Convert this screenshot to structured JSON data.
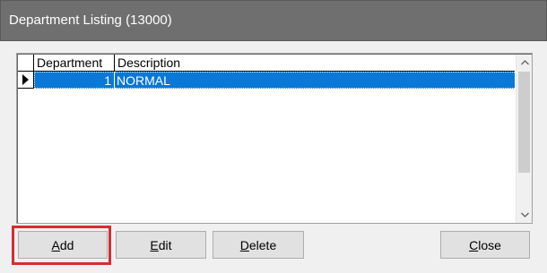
{
  "window": {
    "title": "Department Listing (13000)"
  },
  "grid": {
    "columns": [
      "Department",
      "Description"
    ],
    "rows": [
      {
        "department": "1",
        "description": "NORMAL",
        "selected": true
      }
    ]
  },
  "buttons": {
    "add": {
      "mnemonic": "A",
      "rest": "dd"
    },
    "edit": {
      "mnemonic": "E",
      "rest": "dit"
    },
    "delete": {
      "mnemonic": "D",
      "rest": "elete"
    },
    "close": {
      "mnemonic": "C",
      "rest": "lose"
    }
  },
  "colors": {
    "titlebar": "#6f6f6f",
    "selection": "#0a78d7",
    "highlight": "#d32f2f"
  },
  "icons": {
    "row_indicator": "current-row-arrow-icon",
    "scroll_up": "chevron-up-icon",
    "scroll_down": "chevron-down-icon"
  }
}
